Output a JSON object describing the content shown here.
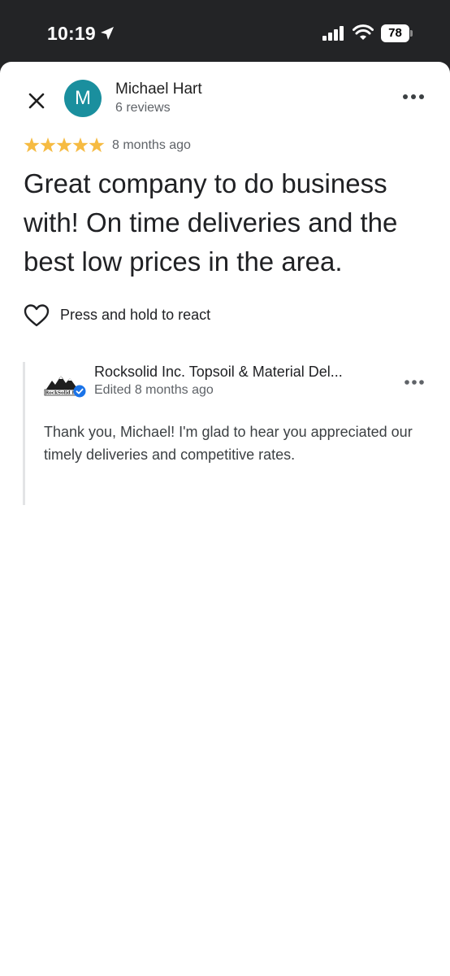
{
  "status_bar": {
    "time": "10:19",
    "battery_level": "78",
    "icons": [
      "location-arrow-icon",
      "cellular-signal-icon",
      "wifi-icon",
      "battery-icon"
    ]
  },
  "review": {
    "reviewer": {
      "initial": "M",
      "name": "Michael Hart",
      "review_count": "6 reviews",
      "avatar_color": "#1a8f9e"
    },
    "rating": 5,
    "star_color": "#f6bb42",
    "time_ago": "8 months ago",
    "text": "Great company to do business with! On time deliveries and the best low prices in the area.",
    "react_label": "Press and hold to react"
  },
  "owner_response": {
    "logo_text": "RockSolid Inc.",
    "name": "Rocksolid Inc. Topsoil & Material Del...",
    "edited": "Edited 8 months ago",
    "text": "Thank you, Michael! I'm glad to hear you appreciated our timely deliveries and competitive rates.",
    "verified_color": "#1a73e8"
  }
}
